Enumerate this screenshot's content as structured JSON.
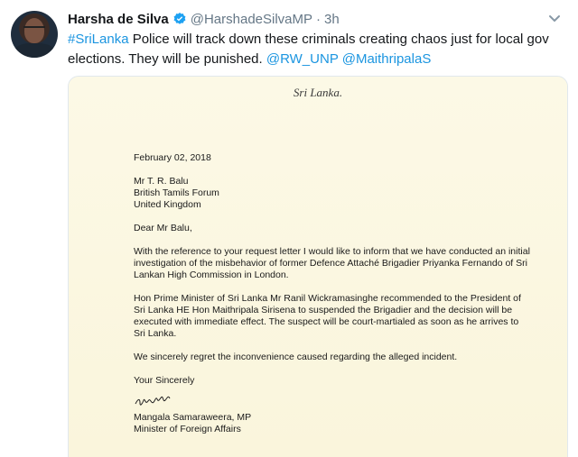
{
  "tweet": {
    "display_name": "Harsha de Silva",
    "handle": "@HarshadeSilvaMP",
    "separator": "·",
    "time": "3h",
    "text_segments": [
      {
        "text": "#SriLanka",
        "link": true
      },
      {
        "text": " Police will track down these criminals creating chaos just for local gov elections. They will be punished. ",
        "link": false
      },
      {
        "text": "@RW_UNP",
        "link": true
      },
      {
        "text": " ",
        "link": false
      },
      {
        "text": "@MaithripalaS",
        "link": true
      }
    ],
    "icons": {
      "verified": "verified-badge-icon",
      "menu": "chevron-down-icon"
    },
    "colors": {
      "link": "#1b95e0",
      "secondary": "#657786",
      "verified": "#1da1f2"
    }
  },
  "letter": {
    "letterhead": "Sri Lanka.",
    "date": "February 02, 2018",
    "recipient": [
      "Mr T. R. Balu",
      "British Tamils Forum",
      "United Kingdom"
    ],
    "salutation": "Dear Mr Balu,",
    "paragraphs": [
      "With the reference to your request letter I would like to inform that we have conducted an initial investigation of the misbehavior of former Defence Attaché Brigadier Priyanka Fernando of Sri Lankan High Commission in London.",
      "Hon Prime Minister of Sri Lanka Mr Ranil Wickramasinghe recommended to the President of Sri Lanka HE Hon Maithripala Sirisena to suspended the Brigadier and the decision will be executed with immediate effect. The suspect will be court-martialed as soon as he arrives to Sri Lanka.",
      "We sincerely regret the inconvenience caused regarding the alleged incident."
    ],
    "closing": "Your Sincerely",
    "signature_name": "Mangala Samaraweera, MP",
    "signature_title": "Minister of Foreign Affairs"
  }
}
